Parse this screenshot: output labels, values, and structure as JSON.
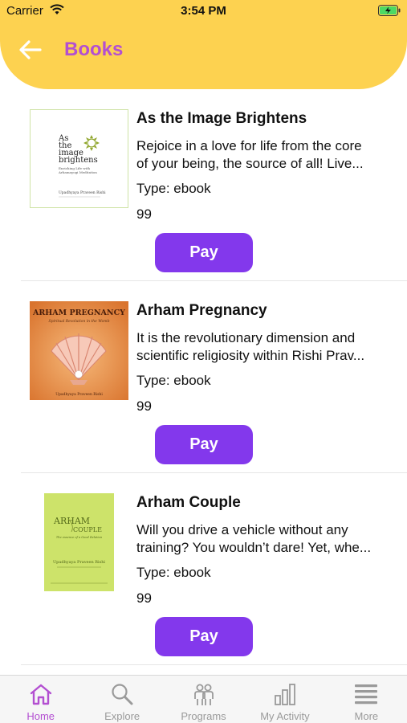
{
  "status_bar": {
    "carrier": "Carrier",
    "time": "3:54 PM"
  },
  "header": {
    "title": "Books",
    "back_icon": "arrow-left-icon"
  },
  "colors": {
    "header_bg": "#fdd250",
    "title_color": "#b34fd1",
    "pay_button": "#8338ec",
    "active_tab": "#b34fd1",
    "inactive_tab": "#9a9a9a"
  },
  "books": [
    {
      "title": "As the Image Brightens",
      "description_lines": [
        "Rejoice in a love for life from the core",
        "of your being, the source of all! Live..."
      ],
      "type": "Type: ebook",
      "price": "99",
      "pay_label": "Pay",
      "cover": {
        "line1": "As",
        "line2": "the",
        "line3": "image",
        "line4": "brightens",
        "subtitle": "Enriching Life with",
        "subtitle2": "Arhamayogi Meditation",
        "author": "Upadhyaya Praveen Rishi"
      }
    },
    {
      "title": "Arham Pregnancy",
      "description_lines": [
        "It is the revolutionary dimension and",
        "scientific religiosity within Rishi Prav..."
      ],
      "type": "Type: ebook",
      "price": "99",
      "pay_label": "Pay",
      "cover": {
        "heading": "ARHAM PREGNANCY",
        "subtitle": "Spiritual Revolution in the Womb",
        "author": "Upadhyaya Praveen Rishi"
      }
    },
    {
      "title": "Arham Couple",
      "description_lines": [
        "Will you drive a vehicle without any",
        "training? You wouldn’t dare! Yet, whe..."
      ],
      "type": "Type: ebook",
      "price": "99",
      "pay_label": "Pay",
      "cover": {
        "line1": "ARHAM",
        "line2": "COUPLE",
        "subtitle": "The essence of a Good Relation",
        "author": "Upadhyaya Praveen Rishi"
      }
    }
  ],
  "tabs": [
    {
      "label": "Home",
      "icon": "home-icon",
      "active": true
    },
    {
      "label": "Explore",
      "icon": "search-icon",
      "active": false
    },
    {
      "label": "Programs",
      "icon": "people-icon",
      "active": false
    },
    {
      "label": "My Activity",
      "icon": "bar-chart-icon",
      "active": false
    },
    {
      "label": "More",
      "icon": "menu-icon",
      "active": false
    }
  ]
}
